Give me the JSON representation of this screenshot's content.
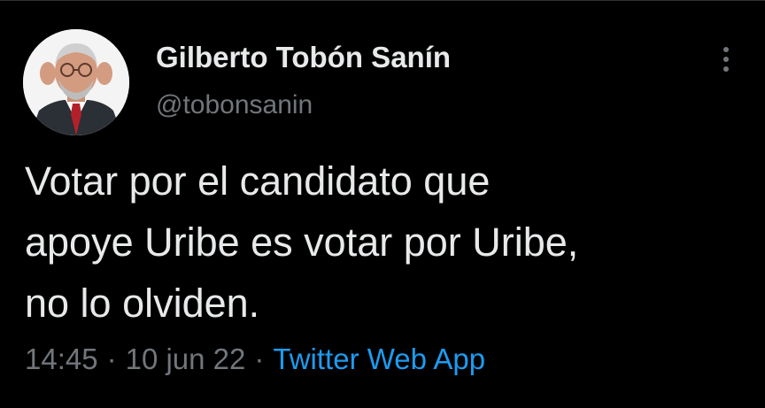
{
  "tweet": {
    "display_name": "Gilberto Tobón Sanín",
    "handle": "@tobonsanin",
    "text_lines": [
      "Votar por el candidato que",
      "apoye Uribe es votar por Uribe,",
      "no lo olviden."
    ],
    "time": "14:45",
    "date": "10 jun 22",
    "separator": "·",
    "source": "Twitter Web App",
    "more_icon": "vertical-ellipsis-icon"
  },
  "colors": {
    "background": "#000000",
    "text_primary": "#e7e9ea",
    "text_secondary": "#71767b",
    "link": "#1d9bf0"
  }
}
